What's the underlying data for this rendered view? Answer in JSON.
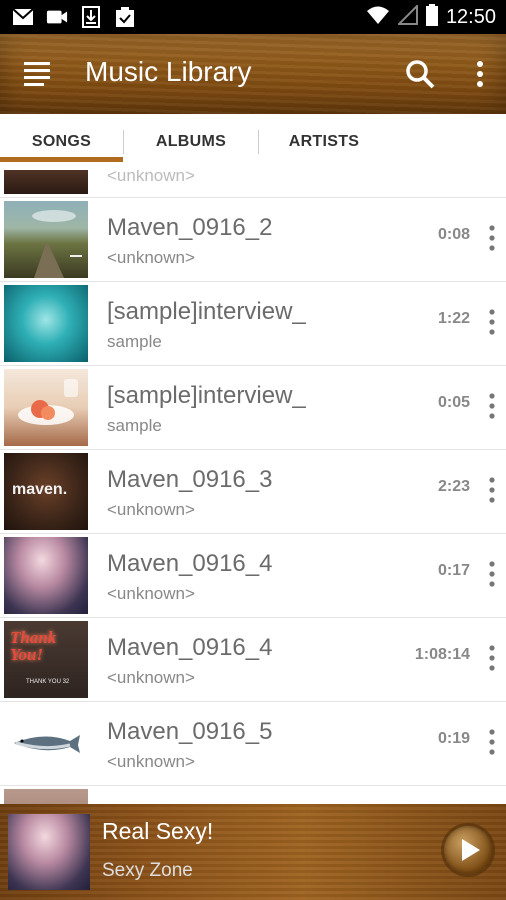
{
  "status_bar": {
    "time": "12:50"
  },
  "app_bar": {
    "title": "Music Library"
  },
  "tabs": [
    {
      "label": "SONGS",
      "active": true
    },
    {
      "label": "ALBUMS",
      "active": false
    },
    {
      "label": "ARTISTS",
      "active": false
    }
  ],
  "songs": [
    {
      "title": "",
      "subtitle": "<unknown>",
      "duration": ""
    },
    {
      "title": "Maven_0916_2",
      "subtitle": "<unknown>",
      "duration": "0:08"
    },
    {
      "title": "[sample]interview_",
      "subtitle": "sample",
      "duration": "1:22"
    },
    {
      "title": "[sample]interview_",
      "subtitle": "sample",
      "duration": "0:05"
    },
    {
      "title": "Maven_0916_3",
      "subtitle": "<unknown>",
      "duration": "2:23"
    },
    {
      "title": "Maven_0916_4",
      "subtitle": "<unknown>",
      "duration": "0:17"
    },
    {
      "title": "Maven_0916_4",
      "subtitle": "<unknown>",
      "duration": "1:08:14"
    },
    {
      "title": "Maven_0916_5",
      "subtitle": "<unknown>",
      "duration": "0:19"
    }
  ],
  "album_art": {
    "row3_text": "maven.",
    "row6_text": "Thank You!",
    "row6_caption": "THANK YOU 32"
  },
  "now_playing": {
    "title": "Real Sexy!",
    "artist": "Sexy Zone"
  },
  "colors": {
    "accent": "#b16b1f",
    "appbar_wood": "#8b5517",
    "text_primary": "#6b6b6b",
    "text_secondary": "#888888"
  }
}
